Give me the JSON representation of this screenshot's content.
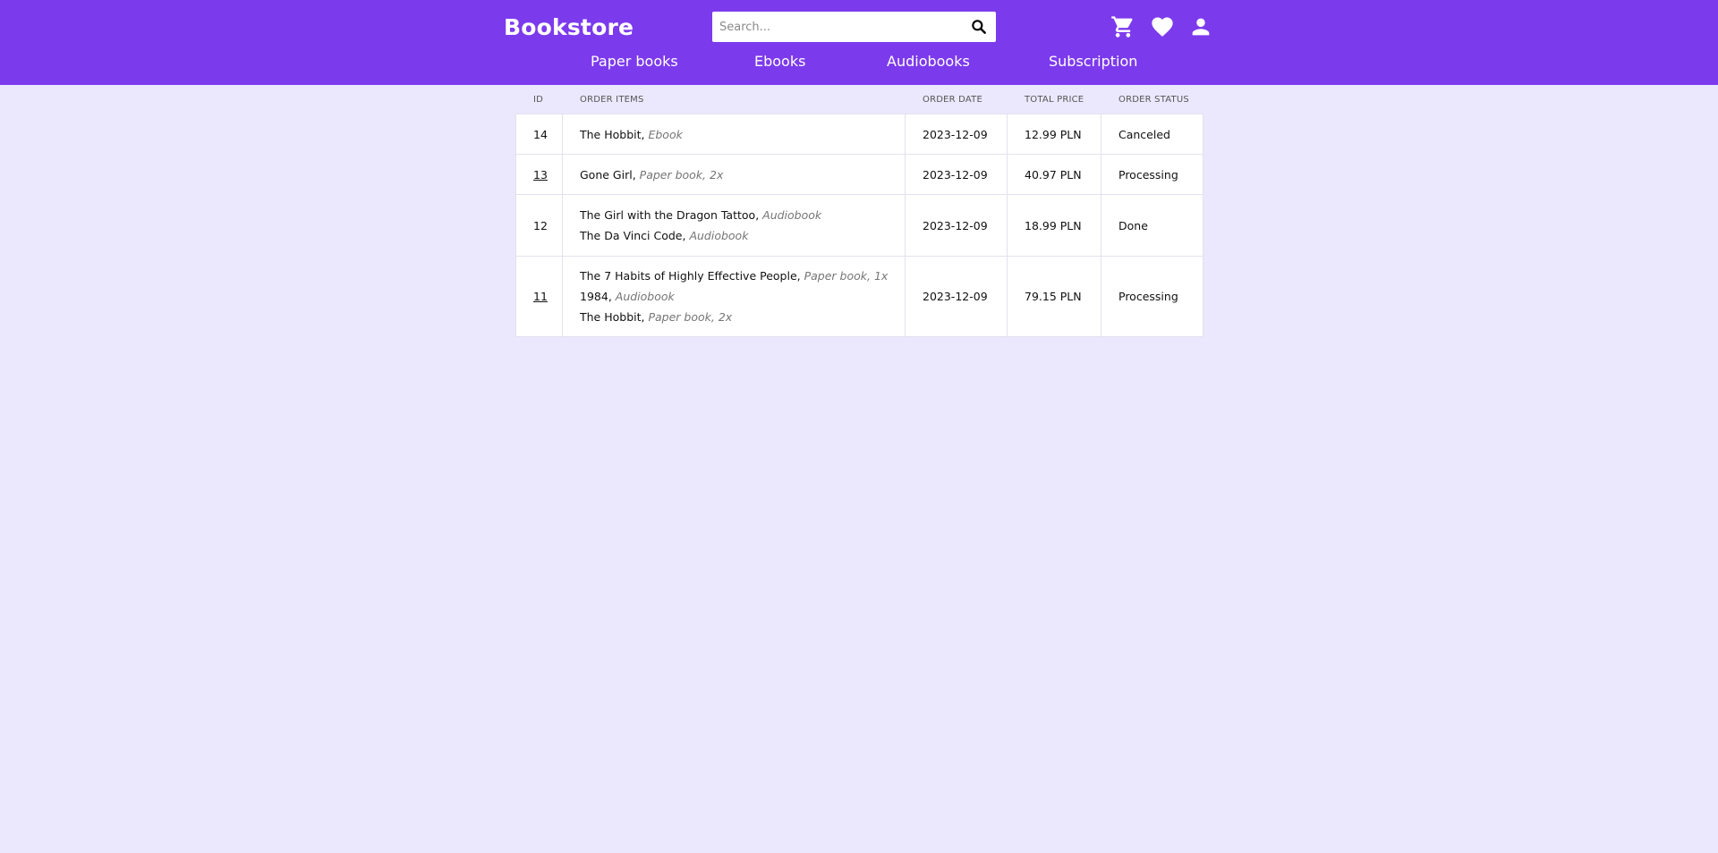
{
  "header": {
    "brand": "Bookstore",
    "search": {
      "placeholder": "Search...",
      "value": ""
    },
    "icons": [
      "cart-icon",
      "heart-icon",
      "user-icon"
    ],
    "nav": [
      "Paper books",
      "Ebooks",
      "Audiobooks",
      "Subscription"
    ]
  },
  "orders": {
    "columns": {
      "id": "ID",
      "items": "ORDER ITEMS",
      "date": "ORDER DATE",
      "price": "TOTAL PRICE",
      "status": "ORDER STATUS"
    },
    "rows": [
      {
        "id": "14",
        "linked": false,
        "items": [
          {
            "title": "The Hobbit",
            "sep": ", ",
            "detail": "Ebook"
          }
        ],
        "date": "2023-12-09",
        "price": "12.99 PLN",
        "status": "Canceled"
      },
      {
        "id": "13",
        "linked": true,
        "items": [
          {
            "title": "Gone Girl",
            "sep": ", ",
            "detail": "Paper book, 2x"
          }
        ],
        "date": "2023-12-09",
        "price": "40.97 PLN",
        "status": "Processing"
      },
      {
        "id": "12",
        "linked": false,
        "items": [
          {
            "title": "The Girl with the Dragon Tattoo",
            "sep": ", ",
            "detail": "Audiobook"
          },
          {
            "title": "The Da Vinci Code",
            "sep": ", ",
            "detail": "Audiobook"
          }
        ],
        "date": "2023-12-09",
        "price": "18.99 PLN",
        "status": "Done"
      },
      {
        "id": "11",
        "linked": true,
        "items": [
          {
            "title": "The 7 Habits of Highly Effective People",
            "sep": ", ",
            "detail": "Paper book, 1x"
          },
          {
            "title": "1984",
            "sep": ", ",
            "detail": "Audiobook"
          },
          {
            "title": "The Hobbit",
            "sep": ", ",
            "detail": "Paper book, 2x"
          }
        ],
        "date": "2023-12-09",
        "price": "79.15 PLN",
        "status": "Processing"
      }
    ]
  },
  "colors": {
    "accent": "#7c3aed",
    "background": "#ebe8fd"
  }
}
